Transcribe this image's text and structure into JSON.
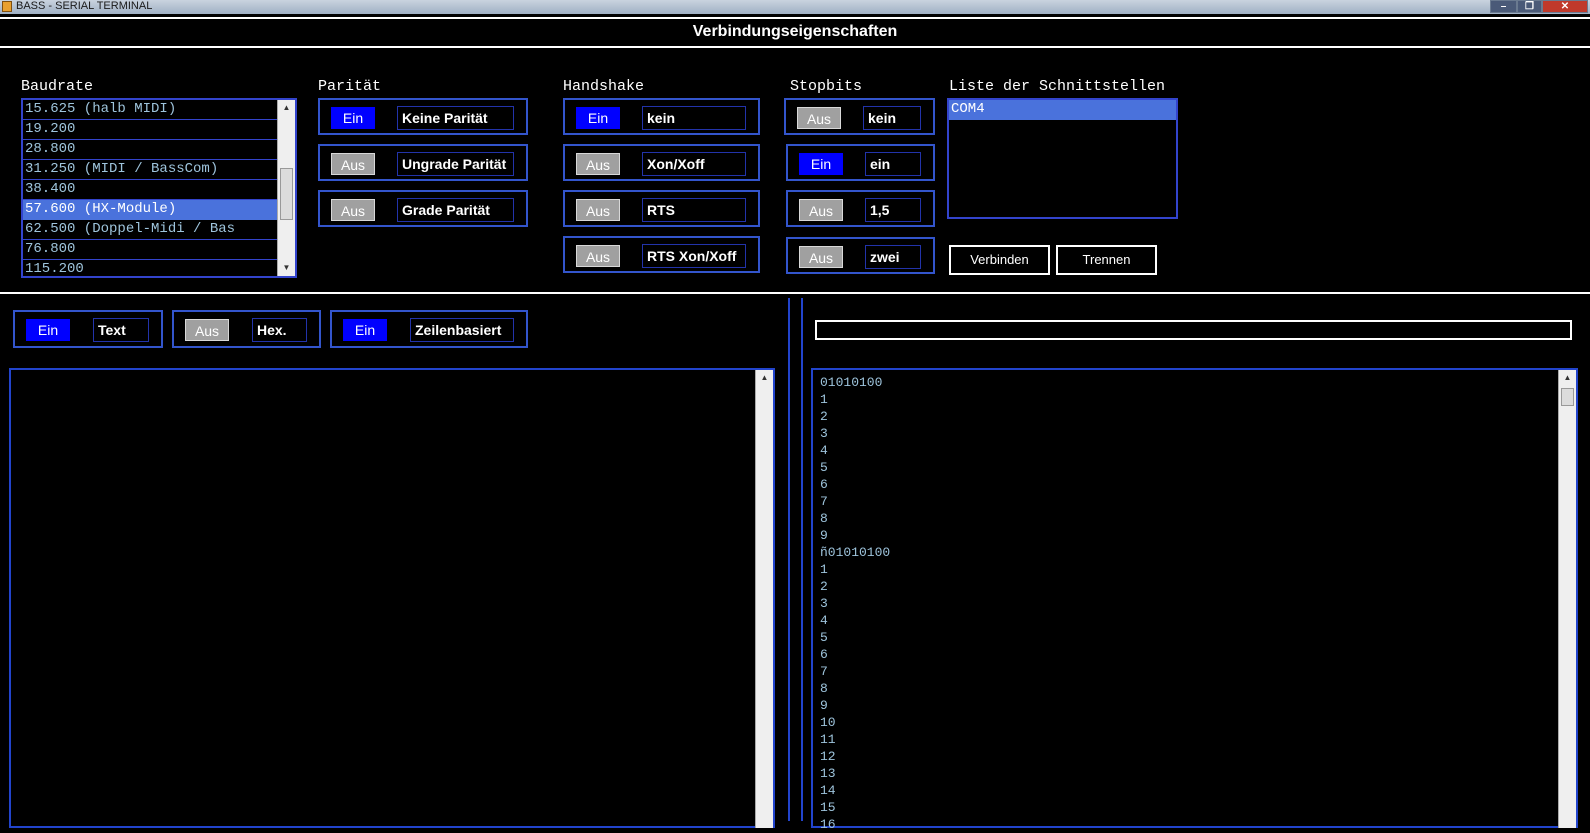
{
  "window": {
    "title": "BASS - SERIAL TERMINAL",
    "minimize": "–",
    "maximize": "❐",
    "close": "✕"
  },
  "section_title": "Verbindungseigenschaften",
  "baudrate": {
    "label": "Baudrate",
    "items": [
      "15.625 (halb MIDI)",
      "19.200",
      "28.800",
      "31.250 (MIDI / BassCom)",
      "38.400",
      "57.600 (HX-Module)",
      "62.500 (Doppel-Midi / Bas",
      "76.800",
      "115.200"
    ]
  },
  "paritaet": {
    "label": "Parität",
    "items": [
      {
        "state": "Ein",
        "label": "Keine Parität"
      },
      {
        "state": "Aus",
        "label": "Ungrade Parität"
      },
      {
        "state": "Aus",
        "label": "Grade Parität"
      }
    ]
  },
  "handshake": {
    "label": "Handshake",
    "items": [
      {
        "state": "Ein",
        "label": "kein"
      },
      {
        "state": "Aus",
        "label": "Xon/Xoff"
      },
      {
        "state": "Aus",
        "label": "RTS"
      },
      {
        "state": "Aus",
        "label": "RTS Xon/Xoff"
      }
    ]
  },
  "stopbits": {
    "label": "Stopbits",
    "items": [
      {
        "state": "Aus",
        "label": "kein"
      },
      {
        "state": "Ein",
        "label": "ein"
      },
      {
        "state": "Aus",
        "label": "1,5"
      },
      {
        "state": "Aus",
        "label": "zwei"
      }
    ]
  },
  "ports": {
    "label": "Liste der Schnittstellen",
    "items": [
      "COM4"
    ],
    "connect_label": "Verbinden",
    "disconnect_label": "Trennen"
  },
  "send_modes": [
    {
      "state": "Ein",
      "label": "Text"
    },
    {
      "state": "Aus",
      "label": "Hex."
    },
    {
      "state": "Ein",
      "label": "Zeilenbasiert"
    }
  ],
  "send_input": {
    "value": ""
  },
  "receive_lines": [
    "01010100",
    "1",
    "2",
    "3",
    "4",
    "5",
    "6",
    "7",
    "8",
    "9",
    "ñ01010100",
    "1",
    "2",
    "3",
    "4",
    "5",
    "6",
    "7",
    "8",
    "9",
    "10",
    "11",
    "12",
    "13",
    "14",
    "15",
    "16"
  ]
}
